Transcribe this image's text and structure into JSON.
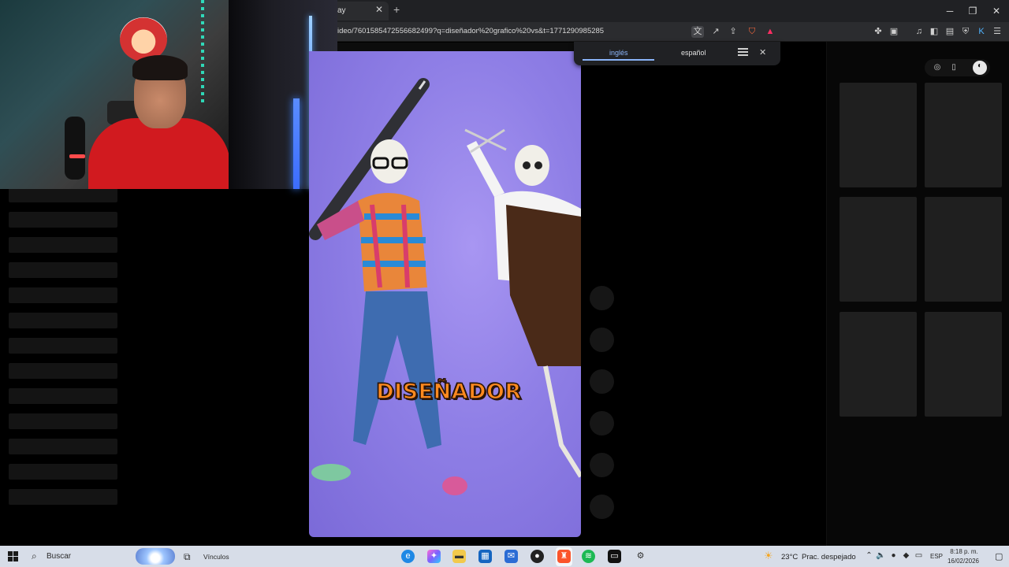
{
  "browser": {
    "tab_title": "ay",
    "tab_close": "✕",
    "new_tab": "+",
    "window": {
      "minimize": "─",
      "restore": "❐",
      "close": "✕"
    },
    "url": "ideo/7601585472556682499?q=diseñador%20grafico%20vs&t=1771290985285"
  },
  "translate_popup": {
    "tab_source": "inglés",
    "tab_target": "español",
    "close": "✕"
  },
  "video": {
    "caption": "DISEÑADOR"
  },
  "taskbar": {
    "search_placeholder": "Buscar",
    "widget_label": "Vínculos",
    "weather_temp": "23°C",
    "weather_desc": "Prac. despejado",
    "language": "ESP",
    "time": "8:18 p. m.",
    "date": "16/02/2026"
  },
  "icons": {
    "translate": "translate-icon",
    "brave": "brave-shield-icon",
    "rewards": "brave-rewards-icon",
    "windows_start": "windows-logo-icon"
  },
  "colors": {
    "accent_blue": "#8ab4f8",
    "video_bg": "#8f7fe6",
    "caption_fill": "#ff8a1f",
    "taskbar_bg": "#d7dde8"
  }
}
